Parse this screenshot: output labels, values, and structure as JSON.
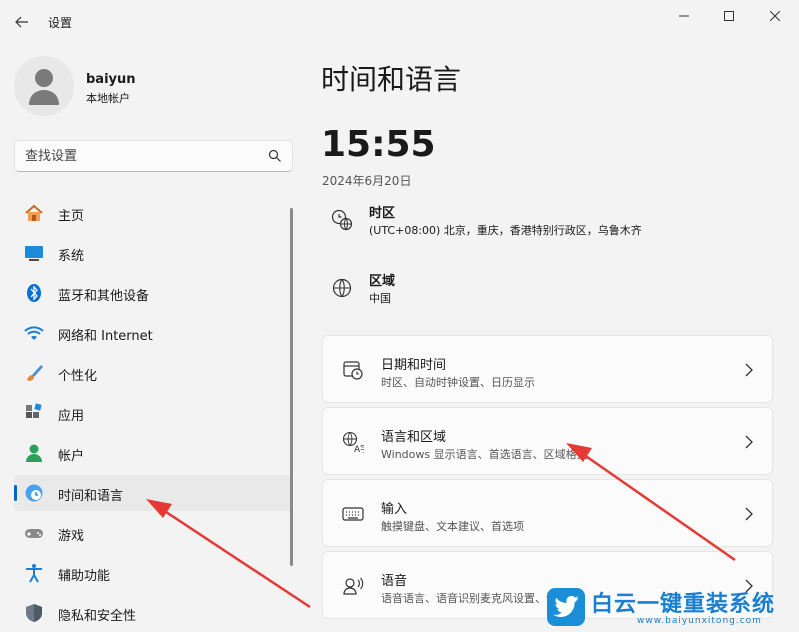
{
  "window": {
    "title": "设置"
  },
  "user": {
    "name": "baiyun",
    "account_type": "本地帐户"
  },
  "search": {
    "placeholder": "查找设置"
  },
  "sidebar": {
    "items": [
      {
        "label": "主页"
      },
      {
        "label": "系统"
      },
      {
        "label": "蓝牙和其他设备"
      },
      {
        "label": "网络和 Internet"
      },
      {
        "label": "个性化"
      },
      {
        "label": "应用"
      },
      {
        "label": "帐户"
      },
      {
        "label": "时间和语言",
        "active": true
      },
      {
        "label": "游戏"
      },
      {
        "label": "辅助功能"
      },
      {
        "label": "隐私和安全性"
      }
    ]
  },
  "main": {
    "title": "时间和语言",
    "time": "15:55",
    "date": "2024年6月20日",
    "timezone": {
      "title": "时区",
      "value": "(UTC+08:00) 北京，重庆，香港特别行政区，乌鲁木齐"
    },
    "region": {
      "title": "区域",
      "value": "中国"
    },
    "cards": [
      {
        "title": "日期和时间",
        "subtitle": "时区、自动时钟设置、日历显示"
      },
      {
        "title": "语言和区域",
        "subtitle": "Windows 显示语言、首选语言、区域格式"
      },
      {
        "title": "输入",
        "subtitle": "触摸键盘、文本建议、首选项"
      },
      {
        "title": "语音",
        "subtitle": "语音语言、语音识别麦克风设置、语音"
      }
    ]
  },
  "watermark": {
    "text": "白云一键重装系统",
    "url": "www.baiyunxitong.com"
  },
  "colors": {
    "accent": "#0067c0",
    "annotation": "#e53935",
    "background": "#f3f3f3"
  }
}
